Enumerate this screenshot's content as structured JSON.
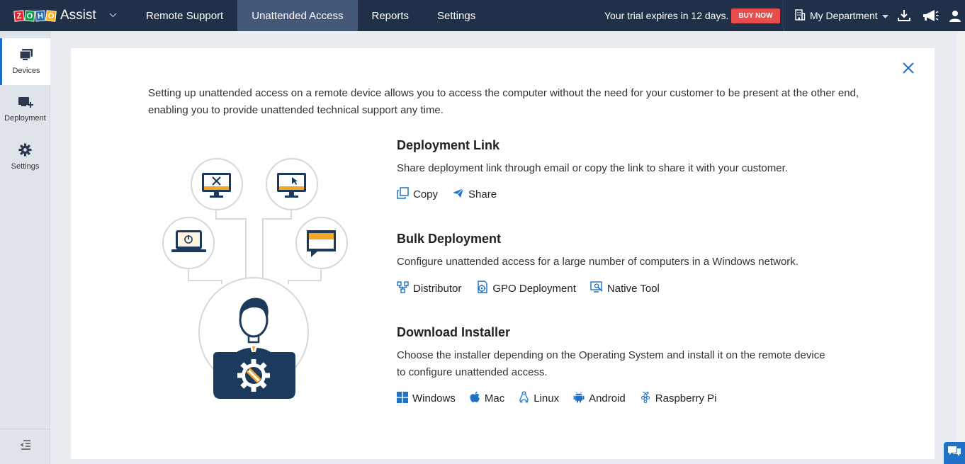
{
  "app": {
    "logo_letters": [
      "Z",
      "O",
      "H",
      "O"
    ],
    "logo_name": "Assist"
  },
  "nav": [
    {
      "label": "Remote Support"
    },
    {
      "label": "Unattended Access",
      "active": true
    },
    {
      "label": "Reports"
    },
    {
      "label": "Settings"
    }
  ],
  "trial": {
    "text": "Your trial expires in 12 days.",
    "buy_label": "BUY NOW"
  },
  "department": {
    "label": "My Department"
  },
  "sidebar": {
    "items": [
      {
        "label": "Devices",
        "icon": "devices-icon",
        "active": true
      },
      {
        "label": "Deployment",
        "icon": "deployment-icon"
      },
      {
        "label": "Settings",
        "icon": "gear-icon"
      }
    ]
  },
  "main": {
    "intro_line1": "Setting up unattended access on a remote device allows you to access the computer without the need for your customer to be present at the other end,",
    "intro_line2": "enabling you to provide unattended technical support any time.",
    "sections": [
      {
        "title": "Deployment Link",
        "description": "Share deployment link through email or copy the link to share it with your customer.",
        "links": [
          {
            "label": "Copy",
            "icon": "copy-icon"
          },
          {
            "label": "Share",
            "icon": "share-icon"
          }
        ]
      },
      {
        "title": "Bulk Deployment",
        "description": "Configure unattended access for a large number of computers in a Windows network.",
        "links": [
          {
            "label": "Distributor",
            "icon": "distributor-icon"
          },
          {
            "label": "GPO Deployment",
            "icon": "gpo-icon"
          },
          {
            "label": "Native Tool",
            "icon": "native-tool-icon"
          }
        ]
      },
      {
        "title": "Download Installer",
        "description_line1": "Choose the installer depending on the Operating System and install it on the remote device",
        "description_line2": "to configure unattended access.",
        "links": [
          {
            "label": "Windows",
            "icon": "windows-icon"
          },
          {
            "label": "Mac",
            "icon": "apple-icon"
          },
          {
            "label": "Linux",
            "icon": "linux-icon"
          },
          {
            "label": "Android",
            "icon": "android-icon"
          },
          {
            "label": "Raspberry Pi",
            "icon": "raspberry-pi-icon"
          }
        ]
      }
    ]
  },
  "colors": {
    "topbar": "#1f3048",
    "nav_active": "#44587a",
    "accent": "#1f72c6",
    "buy_now": "#e84c4c",
    "illustration_navy": "#1b3a5c",
    "illustration_amber": "#f5a623"
  }
}
